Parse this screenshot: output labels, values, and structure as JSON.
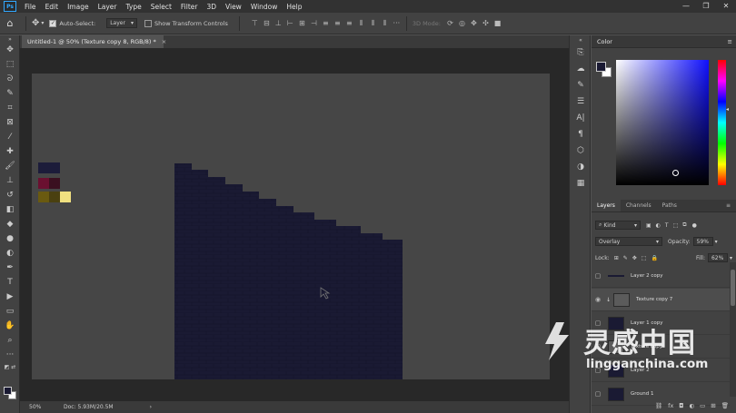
{
  "menubar": {
    "logo": "Ps",
    "items": [
      "File",
      "Edit",
      "Image",
      "Layer",
      "Type",
      "Select",
      "Filter",
      "3D",
      "View",
      "Window",
      "Help"
    ],
    "controls": [
      "—",
      "❐",
      "✕"
    ]
  },
  "options": {
    "auto_select_label": "Auto-Select:",
    "auto_select_target": "Layer",
    "show_transform_label": "Show Transform Controls",
    "mode_3d_label": "3D Mode:"
  },
  "document": {
    "tab_title": "Untitled-1 @ 50% (Texture copy 8, RGB/8) *",
    "close": "×"
  },
  "canvas": {
    "background": "#464646",
    "swatches": [
      {
        "color": "#1c1c3a"
      },
      {
        "color": "#6a1030"
      },
      {
        "color": "#3a1020"
      },
      {
        "color": "#6a5a10"
      },
      {
        "color": "#4a4010"
      },
      {
        "color": "#f0e080"
      }
    ],
    "brick_color": "#1a1a33"
  },
  "status": {
    "zoom": "50%",
    "doc": "Doc: 5.93M/20.5M",
    "arrow": "›"
  },
  "color_panel": {
    "title": "Color",
    "fg": "#1a1a33",
    "bg": "#ffffff"
  },
  "layers_panel": {
    "tabs": [
      "Layers",
      "Channels",
      "Paths"
    ],
    "kind_label": "Kind",
    "blend_mode": "Overlay",
    "opacity_label": "Opacity:",
    "opacity_value": "59%",
    "lock_label": "Lock:",
    "fill_label": "Fill:",
    "fill_value": "62%",
    "layers": [
      {
        "name": "Layer 2 copy",
        "visible": false
      },
      {
        "name": "Texture copy 7",
        "visible": true
      },
      {
        "name": "Layer 1 copy",
        "visible": false
      },
      {
        "name": "Texture copy",
        "visible": false
      },
      {
        "name": "Layer 2",
        "visible": false
      },
      {
        "name": "Ground 1",
        "visible": false
      }
    ]
  },
  "watermark": {
    "cn": "灵感中国",
    "en": "lingganchina.com"
  }
}
